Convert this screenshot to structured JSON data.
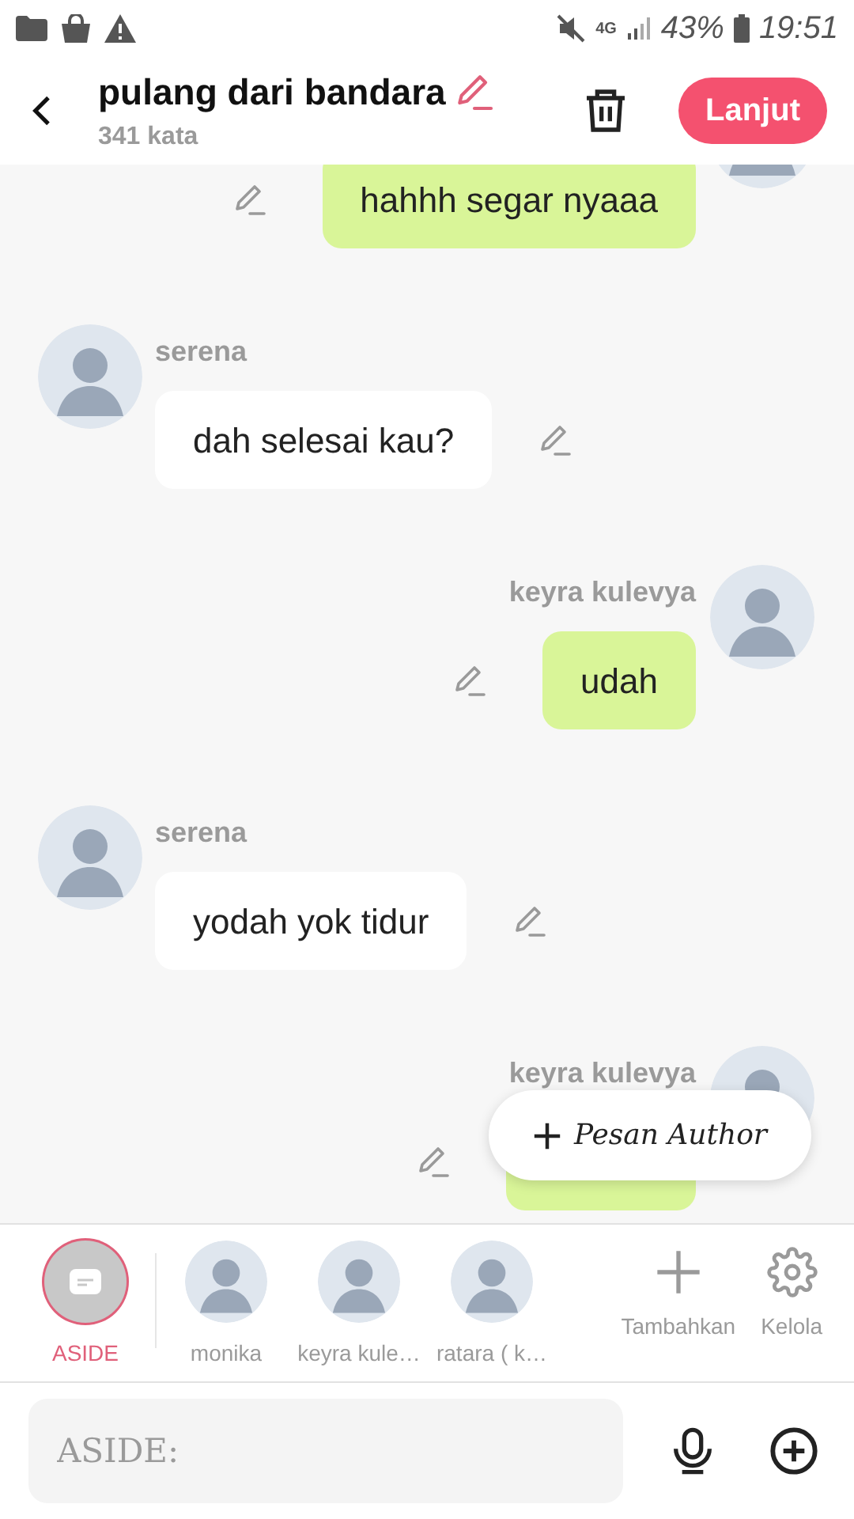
{
  "status_bar": {
    "network": "4G",
    "battery": "43%",
    "time": "19:51"
  },
  "header": {
    "title": "pulang dari bandara",
    "word_count": "341 kata",
    "next_button": "Lanjut"
  },
  "messages": [
    {
      "kind": "sent",
      "text": "hahhh segar nyaaa"
    },
    {
      "kind": "received",
      "name": "serena",
      "text": "dah selesai kau?"
    },
    {
      "kind": "sent",
      "name": "keyra kulevya",
      "text": "udah"
    },
    {
      "kind": "received",
      "name": "serena",
      "text": "yodah yok tidur"
    },
    {
      "kind": "sent",
      "name": "keyra kulevya"
    }
  ],
  "author_message_button": {
    "label": "Pesan Author"
  },
  "characters": [
    {
      "kind": "aside",
      "name": "ASIDE",
      "selected": true
    },
    {
      "kind": "person",
      "name": "monika",
      "selected": false
    },
    {
      "kind": "person",
      "name": "keyra kule…",
      "selected": false
    },
    {
      "kind": "person",
      "name": "ratara ( k…",
      "selected": false
    },
    {
      "kind": "add",
      "name": "Tambahkan"
    },
    {
      "kind": "manage",
      "name": "Kelola"
    }
  ],
  "composer": {
    "placeholder": "ASIDE:"
  }
}
